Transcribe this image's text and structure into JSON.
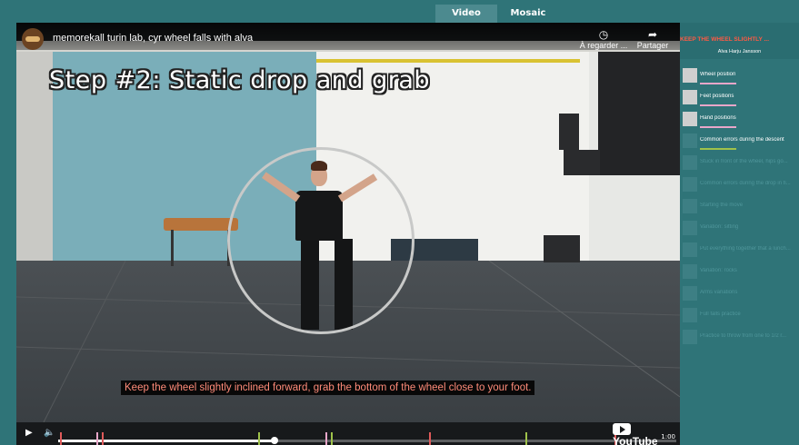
{
  "tabs": [
    {
      "label": "Video",
      "active": true
    },
    {
      "label": "Mosaic",
      "active": false
    }
  ],
  "player": {
    "channel_title": "memorekall turin lab, cyr wheel falls with alva",
    "watch_later_label": "À regarder ...",
    "share_label": "Partager",
    "step_title": "Step #2: Static drop and grab",
    "caption": "Keep the wheel slightly inclined forward, grab the bottom of the wheel close to your foot.",
    "time": "1:00",
    "youtube_logo": "YouTube",
    "progress": 0.35
  },
  "sidebar": {
    "title": "KEEP THE WHEEL SLIGHTLY ...",
    "author": "Alva Harju Jansson",
    "items": [
      {
        "label": "Wheel position",
        "thumb": "light",
        "underline": "#e8a6c9",
        "dim": false
      },
      {
        "label": "Feet positions",
        "thumb": "light",
        "underline": "#e8a6c9",
        "dim": false
      },
      {
        "label": "Hand positions",
        "thumb": "light",
        "underline": "#e8a6c9",
        "dim": false
      },
      {
        "label": "Common errors during the descent",
        "thumb": "dark",
        "underline": "#9fc24a",
        "dim": false
      },
      {
        "label": "Stuck in front of the wheel, hips go...",
        "thumb": "dark",
        "underline": "",
        "dim": true
      },
      {
        "label": "Common errors during the drop in fi...",
        "thumb": "dark",
        "underline": "",
        "dim": true
      },
      {
        "label": "Starting the move",
        "thumb": "dark",
        "underline": "",
        "dim": true
      },
      {
        "label": "Variation: sitting",
        "thumb": "dark",
        "underline": "",
        "dim": true
      },
      {
        "label": "Put everything together that a lunch...",
        "thumb": "dark",
        "underline": "",
        "dim": true
      },
      {
        "label": "Variation: rocks",
        "thumb": "dark",
        "underline": "",
        "dim": true
      },
      {
        "label": "Arms variations",
        "thumb": "dark",
        "underline": "",
        "dim": true
      },
      {
        "label": "Full falls practice",
        "thumb": "dark",
        "underline": "",
        "dim": true
      },
      {
        "label": "Practice to throw from one to 1/2 r...",
        "thumb": "dark",
        "underline": "",
        "dim": true
      }
    ]
  },
  "colors": {
    "background": "#2f7478",
    "accent_red": "#ff5a44",
    "caption_text": "#ff8b79"
  }
}
